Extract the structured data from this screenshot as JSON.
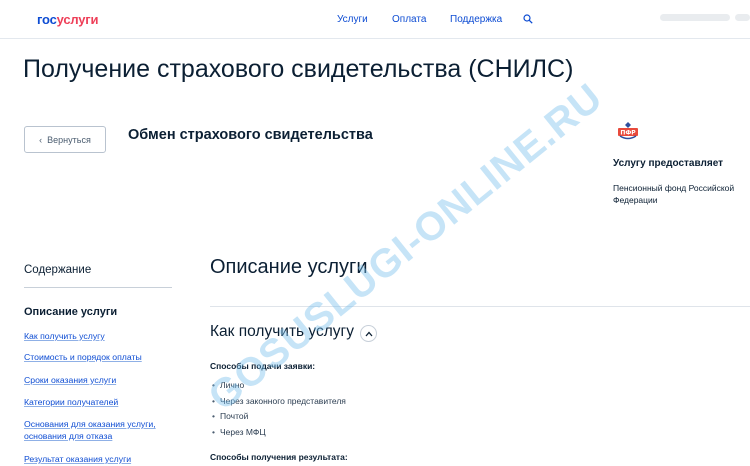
{
  "header": {
    "logo_part1": "гос",
    "logo_part2": "услуги",
    "nav": [
      "Услуги",
      "Оплата",
      "Поддержка"
    ]
  },
  "page": {
    "title": "Получение страхового свидетельства (СНИЛС)",
    "back_label": "Вернуться",
    "service_subtitle": "Обмен страхового свидетельства"
  },
  "provider": {
    "logo_text": "ПФР",
    "heading": "Услугу предоставляет",
    "name": "Пенсионный фонд Российской Федерации"
  },
  "toc": {
    "title": "Содержание",
    "active": "Описание услуги",
    "links": [
      "Как получить услугу",
      "Стоимость и порядок оплаты",
      "Сроки оказания услуги",
      "Категории получателей",
      "Основания для оказания услуги, основания для отказа",
      "Результат оказания услуги"
    ]
  },
  "content": {
    "section_title": "Описание услуги",
    "subsection_title": "Как получить услугу",
    "methods_label": "Способы подачи заявки:",
    "methods": [
      "Лично",
      "Через законного представителя",
      "Почтой",
      "Через МФЦ"
    ],
    "results_label": "Способы получения результата:"
  },
  "watermark": "GOSUSLUGI-ONLINE.RU",
  "colors": {
    "brand_blue": "#0d4cd3",
    "brand_red": "#ee3f58",
    "text_dark": "#0b1f33"
  }
}
